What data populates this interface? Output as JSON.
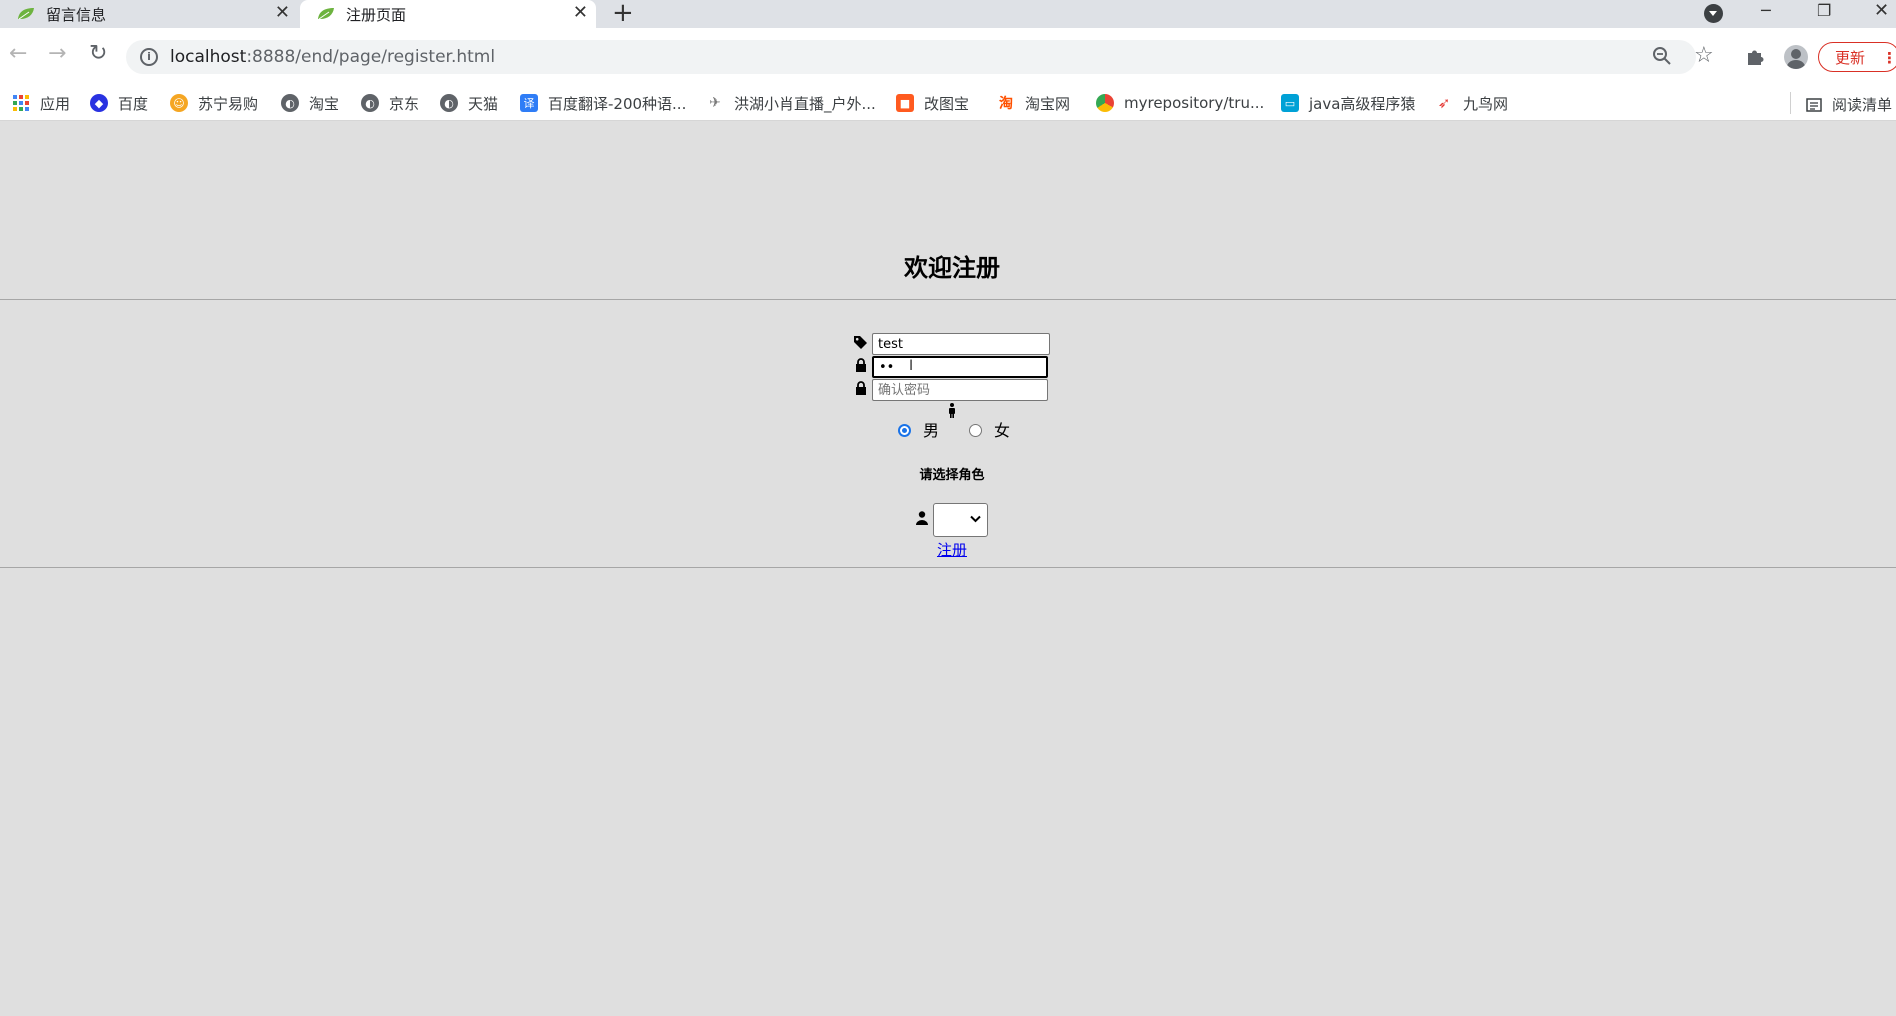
{
  "browser": {
    "tabs": [
      {
        "title": "留言信息",
        "icon": "leaf-favicon",
        "active": false
      },
      {
        "title": "注册页面",
        "icon": "leaf-favicon",
        "active": true
      }
    ],
    "tab_close_glyph": "✕",
    "new_tab_glyph": "+",
    "url_host": "localhost",
    "url_rest": ":8888/end/page/register.html",
    "update_label": "更新",
    "bookmarks": [
      {
        "label": "应用",
        "icon": "apps-grid-icon",
        "color": "#4285f4"
      },
      {
        "label": "百度",
        "icon": "baidu-paw-icon",
        "color": "#2932e1"
      },
      {
        "label": "苏宁易购",
        "icon": "suning-lion-icon",
        "color": "#f5a623"
      },
      {
        "label": "淘宝",
        "icon": "globe-icon",
        "color": "#5f6368"
      },
      {
        "label": "京东",
        "icon": "globe-icon",
        "color": "#5f6368"
      },
      {
        "label": "天猫",
        "icon": "globe-icon",
        "color": "#5f6368"
      },
      {
        "label": "百度翻译-200种语...",
        "icon": "translate-icon",
        "color": "#2f7df6"
      },
      {
        "label": "洪湖小肖直播_户外...",
        "icon": "bird-icon",
        "color": "#7a7a7a"
      },
      {
        "label": "改图宝",
        "icon": "gaitubao-icon",
        "color": "#ff5a1f"
      },
      {
        "label": "淘宝网",
        "icon": "taobao-icon",
        "color": "#ff5000"
      },
      {
        "label": "myrepository/tru...",
        "icon": "chrome-style-icon",
        "color": "#34a853"
      },
      {
        "label": "java高级程序猿",
        "icon": "bilibili-tv-icon",
        "color": "#00a1d6"
      },
      {
        "label": "九鸟网",
        "icon": "red-bird-icon",
        "color": "#e53935"
      }
    ],
    "reading_list_label": "阅读清单"
  },
  "page": {
    "title": "欢迎注册",
    "username_value": "test",
    "password_value": "••",
    "confirm_placeholder": "确认密码",
    "gender_male": "男",
    "gender_female": "女",
    "gender_selected": "男",
    "role_heading": "请选择角色",
    "role_value": "",
    "register_label": "注册"
  }
}
